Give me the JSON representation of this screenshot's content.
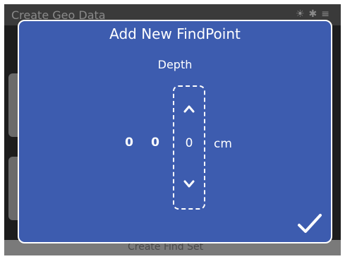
{
  "background": {
    "title": "Create Geo Data",
    "footer_label": "Create Find Set"
  },
  "dialog": {
    "title": "Add New FindPoint",
    "field_label": "Depth",
    "digits": [
      "0",
      "0"
    ],
    "spinner_value": "0",
    "unit": "cm",
    "confirm_icon": "checkmark-icon",
    "increment_icon": "chevron-up-icon",
    "decrement_icon": "chevron-down-icon"
  },
  "colors": {
    "dialog_background": "#3d5caf",
    "dialog_border": "#ffffff",
    "text": "#ffffff"
  }
}
